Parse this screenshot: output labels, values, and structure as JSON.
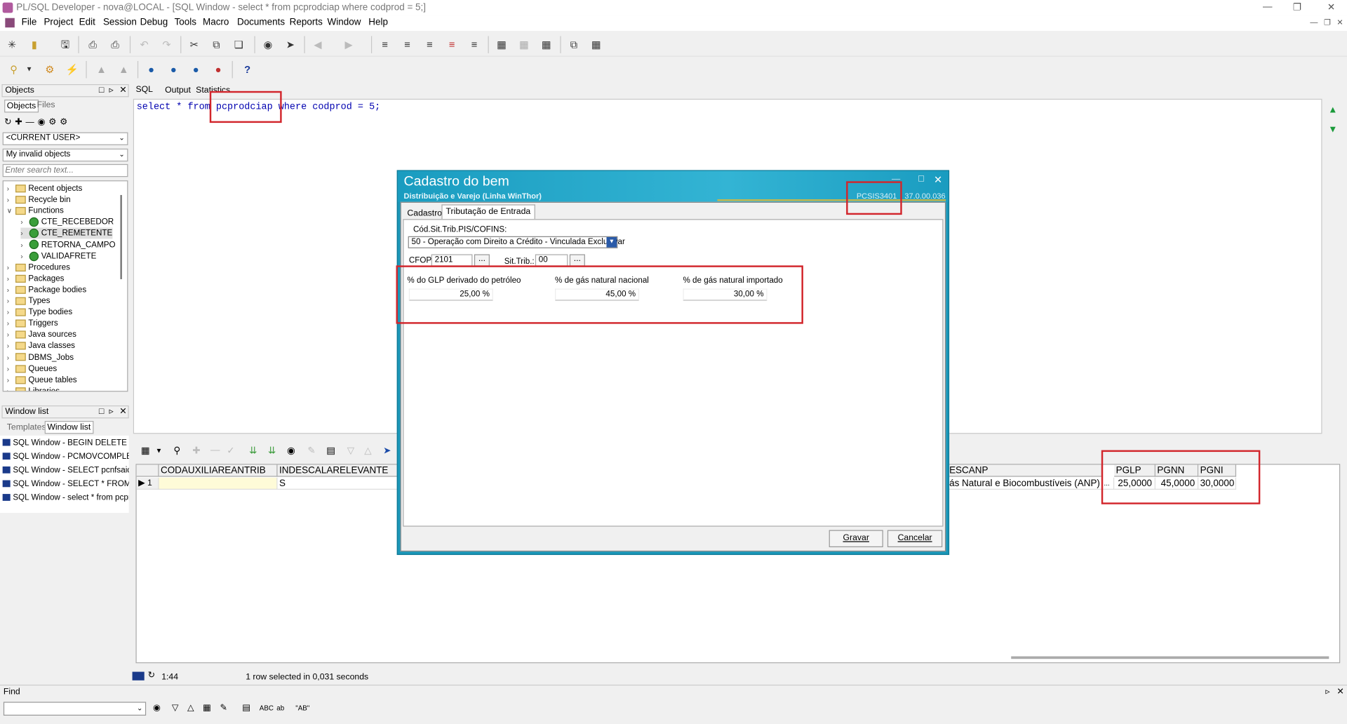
{
  "window": {
    "title": "PL/SQL Developer - nova@LOCAL - [SQL Window - select * from pcprodciap where codprod = 5;]"
  },
  "menu": [
    "File",
    "Project",
    "Edit",
    "Session",
    "Debug",
    "Tools",
    "Macro",
    "Documents",
    "Reports",
    "Window",
    "Help"
  ],
  "objects_panel": {
    "header": "Objects",
    "tabs": [
      "Objects",
      "Files"
    ],
    "user_select": "<CURRENT USER>",
    "filter_select": "My invalid objects",
    "search_placeholder": "Enter search text...",
    "tree": [
      {
        "label": "Recent objects",
        "type": "folder",
        "level": 0
      },
      {
        "label": "Recycle bin",
        "type": "folder",
        "level": 0
      },
      {
        "label": "Functions",
        "type": "folder",
        "level": 0,
        "expanded": true
      },
      {
        "label": "CTE_RECEBEDOR",
        "type": "function",
        "level": 1
      },
      {
        "label": "CTE_REMETENTE",
        "type": "function",
        "level": 1
      },
      {
        "label": "RETORNA_CAMPO",
        "type": "function",
        "level": 1
      },
      {
        "label": "VALIDAFRETE",
        "type": "function",
        "level": 1
      },
      {
        "label": "Procedures",
        "type": "folder",
        "level": 0
      },
      {
        "label": "Packages",
        "type": "folder",
        "level": 0
      },
      {
        "label": "Package bodies",
        "type": "folder",
        "level": 0
      },
      {
        "label": "Types",
        "type": "folder",
        "level": 0
      },
      {
        "label": "Type bodies",
        "type": "folder",
        "level": 0
      },
      {
        "label": "Triggers",
        "type": "folder",
        "level": 0
      },
      {
        "label": "Java sources",
        "type": "folder",
        "level": 0
      },
      {
        "label": "Java classes",
        "type": "folder",
        "level": 0
      },
      {
        "label": "DBMS_Jobs",
        "type": "folder",
        "level": 0
      },
      {
        "label": "Queues",
        "type": "folder",
        "level": 0
      },
      {
        "label": "Queue tables",
        "type": "folder",
        "level": 0
      },
      {
        "label": "Libraries",
        "type": "folder",
        "level": 0
      }
    ]
  },
  "window_list": {
    "header": "Window list",
    "tabs": [
      "Templates",
      "Window list"
    ],
    "items": [
      "SQL Window - BEGIN DELETE FF",
      "SQL Window - PCMOVCOMPLE.s",
      "SQL Window - SELECT pcnfsaid.v",
      "SQL Window - SELECT * FROM P",
      "SQL Window - select * from pcproc"
    ]
  },
  "sql_tabs": [
    "SQL",
    "Output",
    "Statistics"
  ],
  "sql_text": "select * from pcprodciap where codprod = 5;",
  "grid": {
    "columns_left": [
      "CODAUXILIAREANTRIB",
      "INDESCALARELEVANTE"
    ],
    "columns_right": [
      "ESCANP",
      "PGLP",
      "PGNN",
      "PGNI"
    ],
    "row_number": "1",
    "row": {
      "codauxiliareantrib": "",
      "indescalarelevante": "S",
      "escanp": "ás Natural e Biocombustíveis (ANP)",
      "pglp": "25,0000",
      "pgnn": "45,0000",
      "pgni": "30,0000"
    }
  },
  "status": {
    "position": "1:44",
    "message": "1 row selected in 0,031 seconds"
  },
  "find": {
    "label": "Find"
  },
  "dialog": {
    "title": "Cadastro do bem",
    "subtitle": "Distribuição e Varejo (Linha WinThor)",
    "routine": "PCSIS3401",
    "version": "37.0.00.036",
    "tabs": [
      "Cadastro",
      "Tributação de Entrada"
    ],
    "cst_label": "Cód.Sit.Trib.PIS/COFINS:",
    "cst_value": "50 - Operação com Direito a Crédito - Vinculada Exclusivar",
    "cfop_label": "CFOP:",
    "cfop_value": "2101",
    "sittrib_label": "Sit.Trib.:",
    "sittrib_value": "00",
    "ellipsis": "...",
    "glp_label": "% do GLP derivado do petróleo",
    "glp_value": "25,00 %",
    "gnn_label": "% de gás natural nacional",
    "gnn_value": "45,00 %",
    "gni_label": "% de gás natural importado",
    "gni_value": "30,00 %",
    "save_label": "Gravar",
    "cancel_label": "Cancelar"
  },
  "colors": {
    "highlight_box": "#d2262c",
    "dialog_header": "#1a9cc0",
    "sql_keyword": "#0000b0"
  }
}
